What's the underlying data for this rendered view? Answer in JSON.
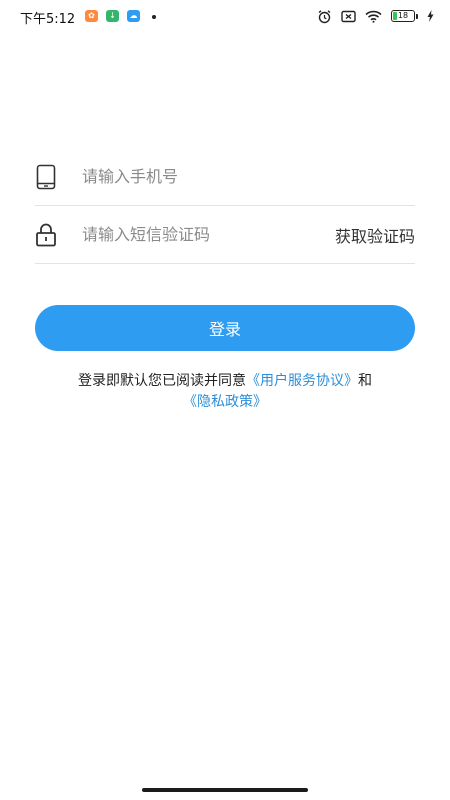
{
  "status_bar": {
    "time": "下午5:12",
    "battery_level": "18",
    "battery_fraction": 0.18,
    "colors": {
      "battery": "#3cc05a"
    },
    "icons": [
      "app-notification-icon",
      "download-icon",
      "cloud-icon",
      "alarm-icon",
      "no-sim-icon",
      "wifi-icon",
      "battery-icon",
      "charging-icon"
    ]
  },
  "login": {
    "phone_placeholder": "请输入手机号",
    "code_placeholder": "请输入短信验证码",
    "get_code_label": "获取验证码",
    "submit_label": "登录",
    "agreement_text": "登录即默认您已阅读并同意",
    "user_agreement_link": "《用户服务协议》",
    "and_text": "和",
    "privacy_link": "《隐私政策》"
  },
  "colors": {
    "accent": "#2e9cf0",
    "link": "#2e8fd8",
    "divider": "#e3e3e3"
  },
  "icons": {
    "phone_field": "phone-icon",
    "code_field": "lock-icon"
  }
}
